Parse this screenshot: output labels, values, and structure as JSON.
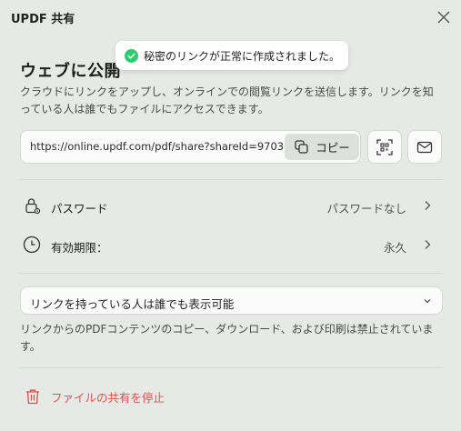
{
  "window": {
    "title": "UPDF 共有"
  },
  "heading": "ウェブに公開",
  "toast": {
    "message": "秘密のリンクが正常に作成されました。"
  },
  "description": "クラウドにリンクをアップし、オンラインでの閲覧リンクを送信します。リンクを知っている人は誰でもファイルにアクセスできます。",
  "link": {
    "url": "https://online.updf.com/pdf/share?shareId=970301...",
    "copy_label": "コピー"
  },
  "settings": {
    "password": {
      "label": "パスワード",
      "value": "パスワードなし"
    },
    "expiry": {
      "label": "有効期限：",
      "value": "永久"
    }
  },
  "access": {
    "selected": "リンクを持っている人は誰でも表示可能"
  },
  "note": "リンクからのPDFコンテンツのコピー、ダウンロード、および印刷は禁止されています。",
  "stop_share": {
    "label": "ファイルの共有を停止"
  },
  "colors": {
    "accent_green": "#2ecc71",
    "danger": "#e0504a",
    "background": "#e6e9e5"
  },
  "icons": [
    "close-icon",
    "check-circle-icon",
    "copy-icon",
    "qr-code-icon",
    "mail-icon",
    "lock-icon",
    "clock-icon",
    "chevron-right-icon",
    "chevron-down-icon",
    "trash-icon"
  ]
}
